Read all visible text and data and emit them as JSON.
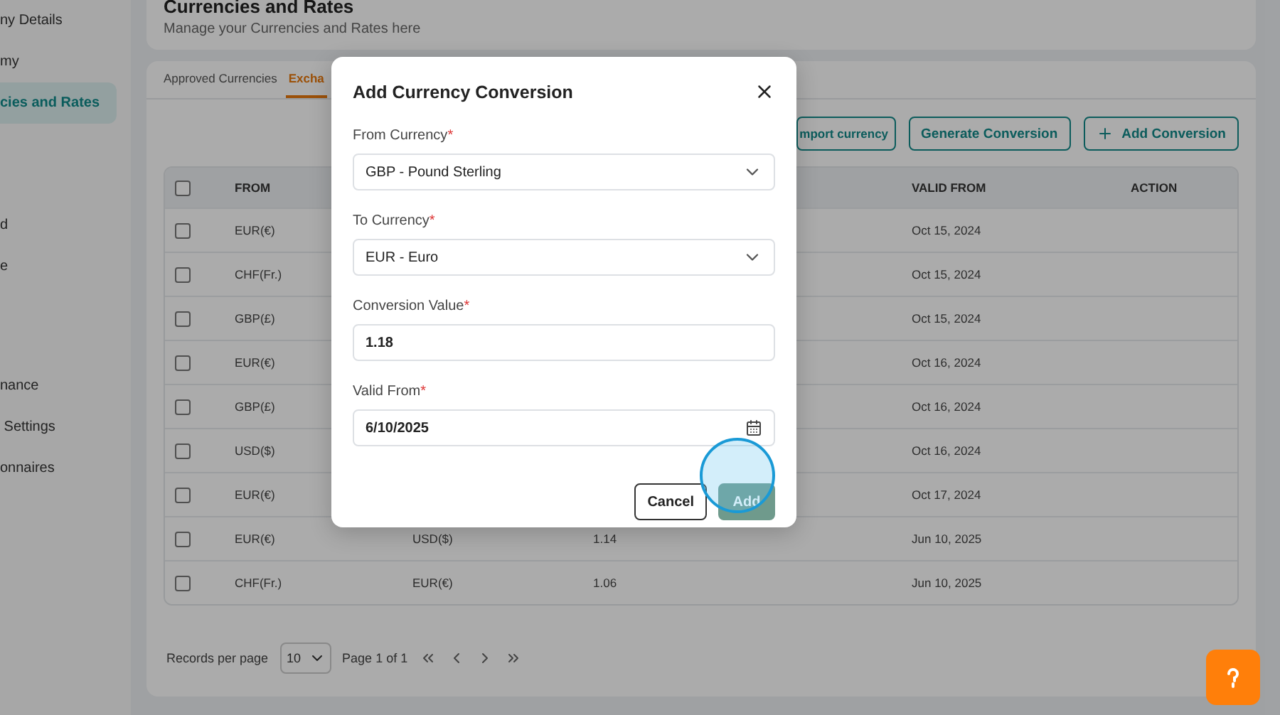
{
  "sidebar": {
    "items": [
      {
        "label": "ny Details",
        "selected": false
      },
      {
        "label": "my",
        "selected": false
      },
      {
        "label": "cies and Rates",
        "selected": true
      },
      {
        "label": "d",
        "selected": false
      },
      {
        "label": "e",
        "selected": false
      },
      {
        "label": "nance",
        "selected": false
      },
      {
        "label": " Settings",
        "selected": false
      },
      {
        "label": "onnaires",
        "selected": false
      }
    ]
  },
  "header": {
    "title": "Currencies and Rates",
    "subtitle": "Manage your Currencies and Rates here"
  },
  "tabs": [
    {
      "label": "Approved Currencies",
      "selected": false
    },
    {
      "label": "Excha",
      "selected": true
    }
  ],
  "toolbar": {
    "buttons": [
      {
        "label": "mport currency",
        "kind": "outline"
      },
      {
        "label": "Generate Conversion",
        "kind": "outline"
      },
      {
        "label": "Add Conversion",
        "kind": "add"
      }
    ]
  },
  "table": {
    "header_checked": false,
    "headers": {
      "from": "FROM",
      "valid_from": "VALID FROM",
      "action": "ACTION"
    },
    "rows": [
      {
        "from": "EUR(€)",
        "valid_from": "Oct 15, 2024",
        "checked": false
      },
      {
        "from": "CHF(Fr.)",
        "valid_from": "Oct 15, 2024",
        "checked": false
      },
      {
        "from": "GBP(£)",
        "valid_from": "Oct 15, 2024",
        "checked": false
      },
      {
        "from": "EUR(€)",
        "valid_from": "Oct 16, 2024",
        "checked": false
      },
      {
        "from": "GBP(£)",
        "valid_from": "Oct 16, 2024",
        "checked": false
      },
      {
        "from": "USD($)",
        "valid_from": "Oct 16, 2024",
        "checked": false
      },
      {
        "from": "EUR(€)",
        "valid_from": "Oct 17, 2024",
        "checked": false
      },
      {
        "from": "EUR(€)",
        "to": "USD($)",
        "value": "1.14",
        "valid_from": "Jun 10, 2025",
        "checked": false
      },
      {
        "from": "CHF(Fr.)",
        "to": "EUR(€)",
        "value": "1.06",
        "valid_from": "Jun 10, 2025",
        "checked": false
      }
    ]
  },
  "pagination": {
    "label": "Records per page",
    "per_page": "10",
    "page": "Page 1 of 1"
  },
  "modal": {
    "title": "Add Currency Conversion",
    "fields": [
      {
        "label": "From Currency",
        "required_mark": "*",
        "value": "GBP - Pound Sterling",
        "kind": "select"
      },
      {
        "label": "To Currency",
        "required_mark": "*",
        "value": "EUR - Euro",
        "kind": "select"
      },
      {
        "label": "Conversion Value",
        "required_mark": "*",
        "value": "1.18",
        "kind": "text"
      },
      {
        "label": "Valid From",
        "required_mark": "*",
        "value": "6/10/2025",
        "kind": "date"
      }
    ],
    "buttons": [
      {
        "label": "Cancel",
        "kind": "secondary"
      },
      {
        "label": "Add",
        "kind": "primary"
      }
    ]
  }
}
